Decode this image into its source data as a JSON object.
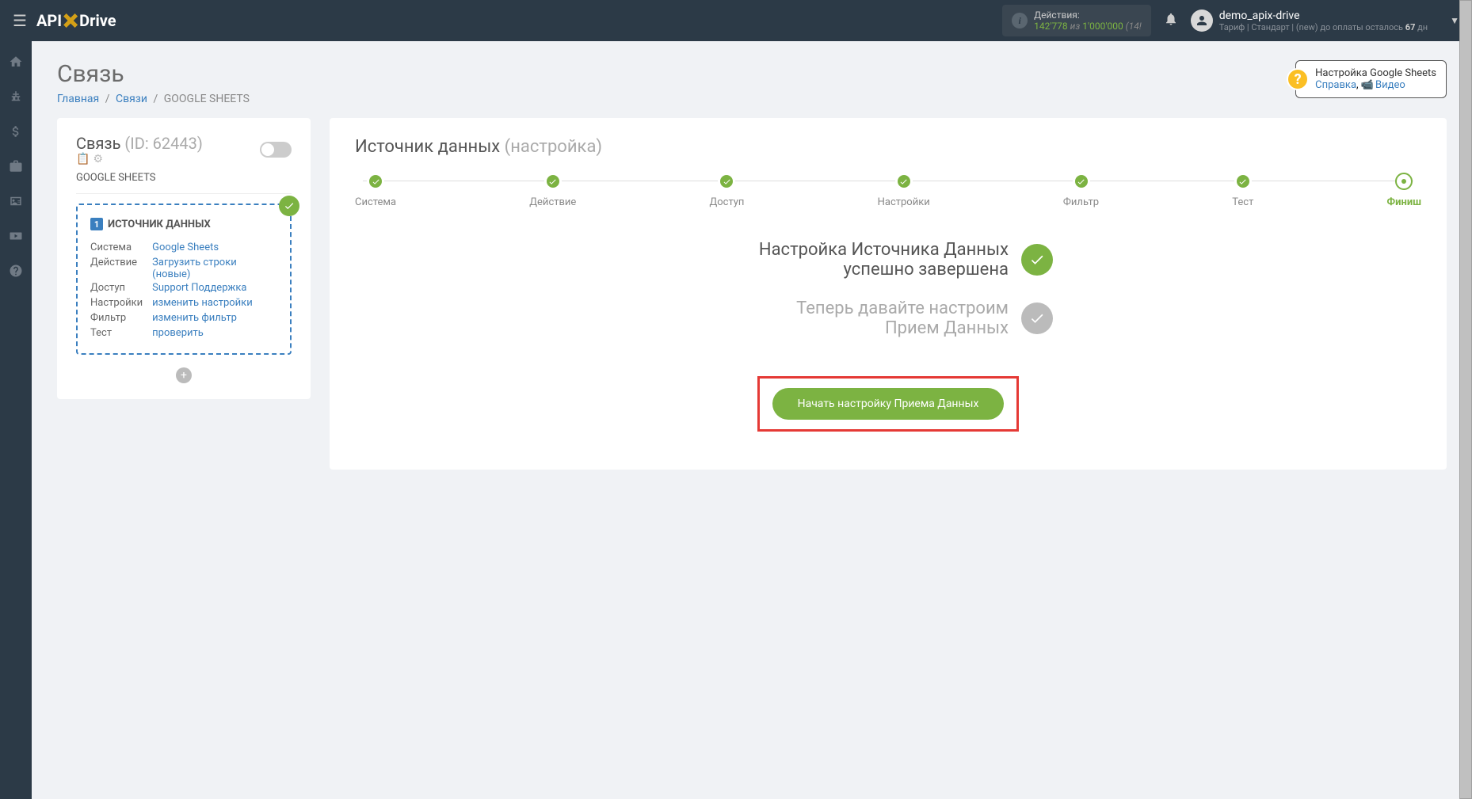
{
  "topbar": {
    "logo": {
      "part1": "API",
      "part2": "Drive"
    },
    "actions": {
      "label": "Действия:",
      "current": "142'778",
      "of": "из",
      "max": "1'000'000",
      "extra": "(14!"
    },
    "user": {
      "name": "demo_apix-drive",
      "tariff_label": "Тариф",
      "tariff_name": "Стандарт",
      "status": "(new) до оплаты осталось",
      "days": "67",
      "days_unit": "дн"
    }
  },
  "page": {
    "title": "Связь",
    "breadcrumbs": {
      "home": "Главная",
      "links": "Связи",
      "current": "GOOGLE SHEETS"
    }
  },
  "helpbox": {
    "title": "Настройка Google Sheets",
    "help_link": "Справка",
    "video_link": "Видео"
  },
  "left": {
    "title": "Связь",
    "id_label": "(ID: 62443)",
    "subtitle": "GOOGLE SHEETS",
    "card": {
      "title": "ИСТОЧНИК ДАННЫХ",
      "rows": [
        {
          "k": "Система",
          "v": "Google Sheets"
        },
        {
          "k": "Действие",
          "v": "Загрузить строки (новые)"
        },
        {
          "k": "Доступ",
          "v": "Support Поддержка"
        },
        {
          "k": "Настройки",
          "v": "изменить настройки"
        },
        {
          "k": "Фильтр",
          "v": "изменить фильтр"
        },
        {
          "k": "Тест",
          "v": "проверить"
        }
      ]
    }
  },
  "right": {
    "heading": "Источник данных",
    "heading_sub": "(настройка)",
    "steps": [
      {
        "label": "Система"
      },
      {
        "label": "Действие"
      },
      {
        "label": "Доступ"
      },
      {
        "label": "Настройки"
      },
      {
        "label": "Фильтр"
      },
      {
        "label": "Тест"
      },
      {
        "label": "Финиш"
      }
    ],
    "status1_line1": "Настройка Источника Данных",
    "status1_line2": "успешно завершена",
    "status2_line1": "Теперь давайте настроим",
    "status2_line2": "Прием Данных",
    "cta": "Начать настройку Приема Данных"
  }
}
